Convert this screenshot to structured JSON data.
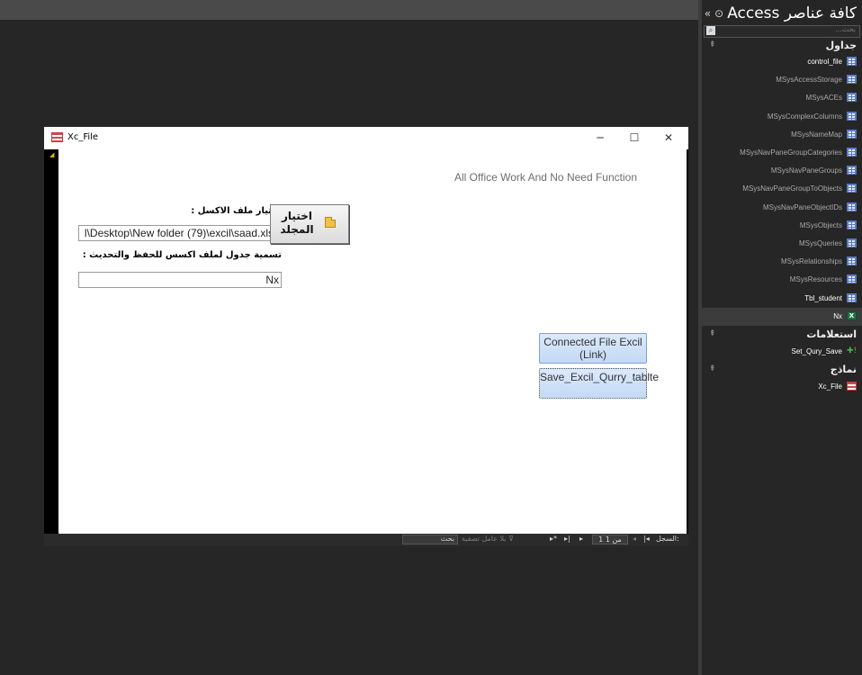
{
  "nav": {
    "title": "كافة عناصر Access",
    "search_placeholder": "بحث...",
    "groups": [
      {
        "label": "جداول",
        "items": [
          {
            "label": "control_file",
            "icon": "table-icon"
          },
          {
            "label": "MSysAccessStorage",
            "icon": "table-icon"
          },
          {
            "label": "MSysACEs",
            "icon": "table-icon"
          },
          {
            "label": "MSysComplexColumns",
            "icon": "table-icon"
          },
          {
            "label": "MSysNameMap",
            "icon": "table-icon"
          },
          {
            "label": "MSysNavPaneGroupCategories",
            "icon": "table-icon"
          },
          {
            "label": "MSysNavPaneGroups",
            "icon": "table-icon"
          },
          {
            "label": "MSysNavPaneGroupToObjects",
            "icon": "table-icon"
          },
          {
            "label": "MSysNavPaneObjectIDs",
            "icon": "table-icon"
          },
          {
            "label": "MSysObjects",
            "icon": "table-icon"
          },
          {
            "label": "MSysQueries",
            "icon": "table-icon"
          },
          {
            "label": "MSysRelationships",
            "icon": "table-icon"
          },
          {
            "label": "MSysResources",
            "icon": "table-icon"
          },
          {
            "label": "Tbl_student",
            "icon": "table-icon"
          },
          {
            "label": "Nx",
            "icon": "excel-link-icon",
            "selected": true
          }
        ]
      },
      {
        "label": "استعلامات",
        "items": [
          {
            "label": "Set_Qury_Save",
            "icon": "append-query-icon"
          }
        ]
      },
      {
        "label": "نماذج",
        "items": [
          {
            "label": "Xc_File",
            "icon": "form-icon"
          }
        ]
      }
    ]
  },
  "form": {
    "title": "Xc_File",
    "subtitle": "All Office Work And No Need Function",
    "excel_label": "اختيار ملف الاكسل :",
    "excel_path": "l\\Desktop\\New folder (79)\\excil\\saad.xlsx",
    "folder_button_label": "اختيار المجلد",
    "table_name_label": "تسمية جدول لملف اكسس للحفظ والتحديث :",
    "table_name_value": "Nx",
    "connect_button_label": "Connected File Excil (Link)",
    "save_button_label": "Save_Excil_Qurry_tablte"
  },
  "recordbar": {
    "record_label": "السجل:",
    "record_position": "1 من 1",
    "filter_label": "بلا عامل تصفية",
    "search_label": "بحث"
  }
}
